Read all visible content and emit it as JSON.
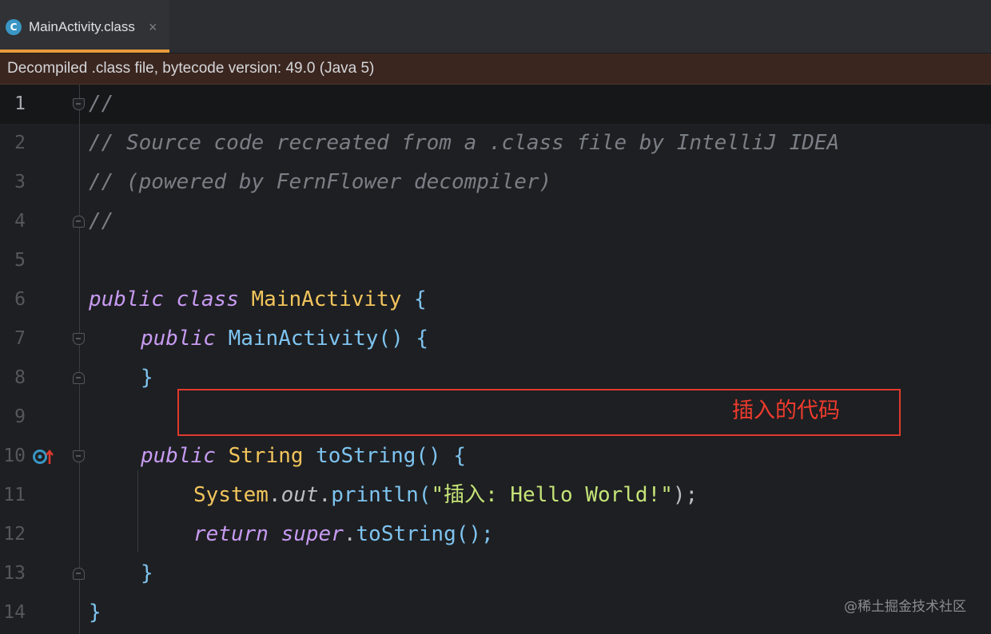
{
  "tab": {
    "icon_letter": "C",
    "label": "MainActivity.class",
    "close_glyph": "×"
  },
  "banner": {
    "text": "Decompiled .class file, bytecode version: 49.0 (Java 5)"
  },
  "editor": {
    "line_numbers": [
      "1",
      "2",
      "3",
      "4",
      "5",
      "6",
      "7",
      "8",
      "9",
      "10",
      "11",
      "12",
      "13",
      "14"
    ],
    "tokens": {
      "l1": "//",
      "l2": "// Source code recreated from a .class file by IntelliJ IDEA",
      "l3": "// (powered by FernFlower decompiler)",
      "l4": "//",
      "l6_kw1": "public",
      "l6_kw2": "class",
      "l6_cls": "MainActivity",
      "l6_brace": "{",
      "l7_kw": "public",
      "l7_fn": "MainActivity",
      "l7_paren": "()",
      "l7_brace": "{",
      "l8_brace": "}",
      "l10_kw": "public",
      "l10_cls": "String",
      "l10_fn": "toString",
      "l10_paren": "()",
      "l10_brace": "{",
      "l11_cls": "System",
      "l11_dot1": ".",
      "l11_fld": "out",
      "l11_dot2": ".",
      "l11_fn": "println",
      "l11_open": "(",
      "l11_str": "\"插入: Hello World!\"",
      "l11_close": ");",
      "l12_kw1": "return",
      "l12_kw2": "super",
      "l12_dot": ".",
      "l12_fn": "toString",
      "l12_end": "();",
      "l13_brace": "}",
      "l14_brace": "}"
    }
  },
  "annotation": {
    "text": "插入的代码",
    "color": "#e0392e"
  },
  "watermark": {
    "text": "@稀土掘金技术社区"
  },
  "colors": {
    "keyword": "#c79bf2",
    "class_name": "#f2c55c",
    "function": "#7ec4f0",
    "string": "#c5e478",
    "comment": "#7a7e85",
    "tab_accent": "#e89a3c"
  },
  "icons": {
    "tab_icon": "java-class-icon",
    "gutter_line_10": "override-method-icon"
  }
}
